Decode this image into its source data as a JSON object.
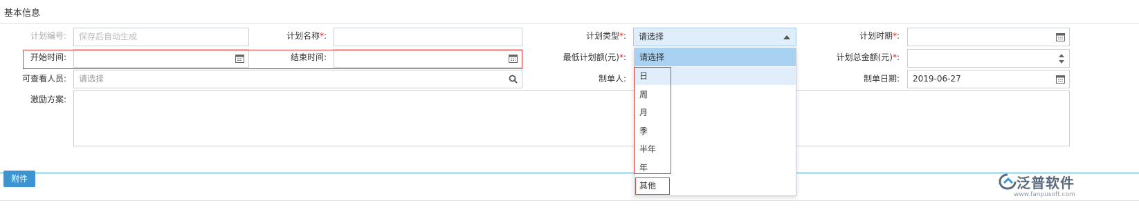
{
  "section": {
    "title": "基本信息"
  },
  "form": {
    "plan_no": {
      "label": "计划编号:",
      "placeholder": "保存后自动生成"
    },
    "plan_name": {
      "label": "计划名称",
      "required_mark": "*",
      "colon": ":",
      "value": ""
    },
    "plan_type": {
      "label": "计划类型",
      "required_mark": "*",
      "colon": ":",
      "value": "请选择"
    },
    "plan_period": {
      "label": "计划时期",
      "required_mark": "*",
      "colon": ":",
      "value": ""
    },
    "start_time": {
      "label": "开始时间:",
      "value": ""
    },
    "end_time": {
      "label": "结束时间:",
      "value": ""
    },
    "min_amount": {
      "label": "最低计划额(元)",
      "required_mark": "*",
      "colon": ":"
    },
    "total_amount": {
      "label": "计划总金额(元)",
      "required_mark": "*",
      "colon": ":",
      "value": ""
    },
    "viewers": {
      "label": "可查看人员:",
      "placeholder": "请选择"
    },
    "creator": {
      "label": "制单人:"
    },
    "create_date": {
      "label": "制单日期:",
      "value": "2019-06-27"
    },
    "incentive": {
      "label": "激励方案:",
      "value": ""
    }
  },
  "dropdown": {
    "options": [
      "请选择",
      "日",
      "周",
      "月",
      "季",
      "半年",
      "年",
      "其他"
    ],
    "selected": "请选择",
    "hovered": "日"
  },
  "buttons": {
    "attach": "附件"
  },
  "logo": {
    "name": "泛普软件",
    "url": "www.fanpusoft.com"
  },
  "colors": {
    "accent": "#3e94d1",
    "highlight": "#e23b3b",
    "dropdown_selected": "#a9d2f2",
    "dropdown_hover": "#dfeefa"
  }
}
